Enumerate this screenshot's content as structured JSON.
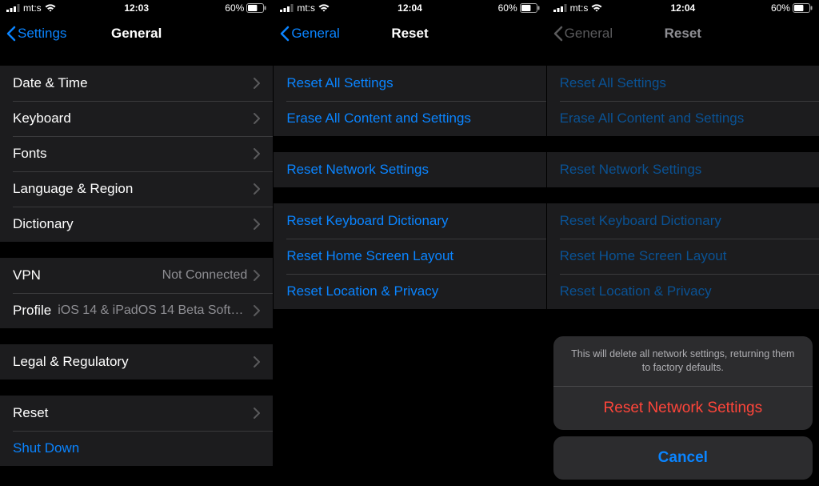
{
  "status": {
    "carrier": "mt:s",
    "battery_pct": "60%",
    "clock1": "12:03",
    "clock2": "12:04",
    "clock3": "12:04"
  },
  "pane1": {
    "back_label": "Settings",
    "title": "General",
    "g1": {
      "r0": "Date & Time",
      "r1": "Keyboard",
      "r2": "Fonts",
      "r3": "Language & Region",
      "r4": "Dictionary"
    },
    "g2": {
      "r0": {
        "label": "VPN",
        "value": "Not Connected"
      },
      "r1": {
        "label": "Profile",
        "value": "iOS 14 & iPadOS 14 Beta Softwar…"
      }
    },
    "g3": {
      "r0": "Legal & Regulatory"
    },
    "g4": {
      "r0": "Reset",
      "r1": "Shut Down"
    }
  },
  "pane2": {
    "back_label": "General",
    "title": "Reset",
    "g1": {
      "r0": "Reset All Settings",
      "r1": "Erase All Content and Settings"
    },
    "g2": {
      "r0": "Reset Network Settings"
    },
    "g3": {
      "r0": "Reset Keyboard Dictionary",
      "r1": "Reset Home Screen Layout",
      "r2": "Reset Location & Privacy"
    }
  },
  "pane3": {
    "back_label": "General",
    "title": "Reset",
    "g1": {
      "r0": "Reset All Settings",
      "r1": "Erase All Content and Settings"
    },
    "g2": {
      "r0": "Reset Network Settings"
    },
    "g3": {
      "r0": "Reset Keyboard Dictionary",
      "r1": "Reset Home Screen Layout",
      "r2": "Reset Location & Privacy"
    },
    "sheet": {
      "message": "This will delete all network settings, returning them to factory defaults.",
      "action": "Reset Network Settings",
      "cancel": "Cancel"
    }
  }
}
